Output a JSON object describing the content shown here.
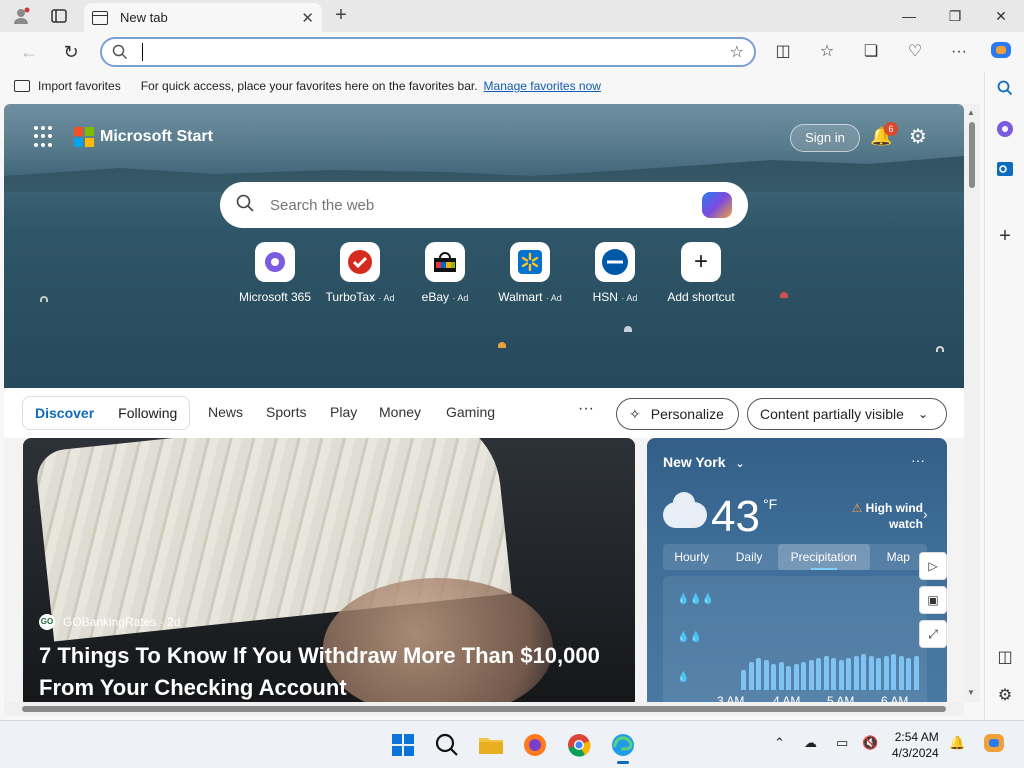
{
  "tab": {
    "title": "New tab",
    "close": "✕"
  },
  "titlebar": {
    "new_tab": "+",
    "minimize": "—",
    "restore": "❐",
    "close": "✕"
  },
  "addressbar": {
    "value": "",
    "placeholder": ""
  },
  "favorites_bar": {
    "import_label": "Import favorites",
    "tip": "For quick access, place your favorites here on the favorites bar.",
    "manage_link": "Manage favorites now"
  },
  "start": {
    "brand": "Microsoft Start",
    "sign_in": "Sign in",
    "notifications_count": "6",
    "search_placeholder": "Search the web",
    "shortcuts": [
      {
        "label": "Microsoft 365",
        "ad": ""
      },
      {
        "label": "TurboTax",
        "ad": "· Ad"
      },
      {
        "label": "eBay",
        "ad": "· Ad"
      },
      {
        "label": "Walmart",
        "ad": "· Ad"
      },
      {
        "label": "HSN",
        "ad": "· Ad"
      },
      {
        "label": "Add shortcut",
        "ad": ""
      }
    ]
  },
  "feed_nav": {
    "discover": "Discover",
    "following": "Following",
    "items": [
      "News",
      "Sports",
      "Play",
      "Money",
      "Gaming"
    ],
    "more": "···",
    "personalize": "Personalize",
    "content_visibility": "Content partially visible"
  },
  "article": {
    "source": "GOBankingRates",
    "age": "· 2d",
    "headline": "7 Things To Know If You Withdraw More Than $10,000 From Your Checking Account"
  },
  "weather": {
    "city": "New York",
    "temperature": "43",
    "unit": "°F",
    "alert": "High wind watch",
    "tabs": [
      "Hourly",
      "Daily",
      "Precipitation",
      "Map"
    ],
    "selected_tab": "Precipitation",
    "hours": [
      "3 AM",
      "4 AM",
      "5 AM",
      "6 AM"
    ]
  },
  "taskbar": {
    "time": "2:54 AM",
    "date": "4/3/2024"
  },
  "colors": {
    "accent": "#0f6cbd",
    "hero": "#2f5668",
    "weather": "#3d6d98"
  }
}
